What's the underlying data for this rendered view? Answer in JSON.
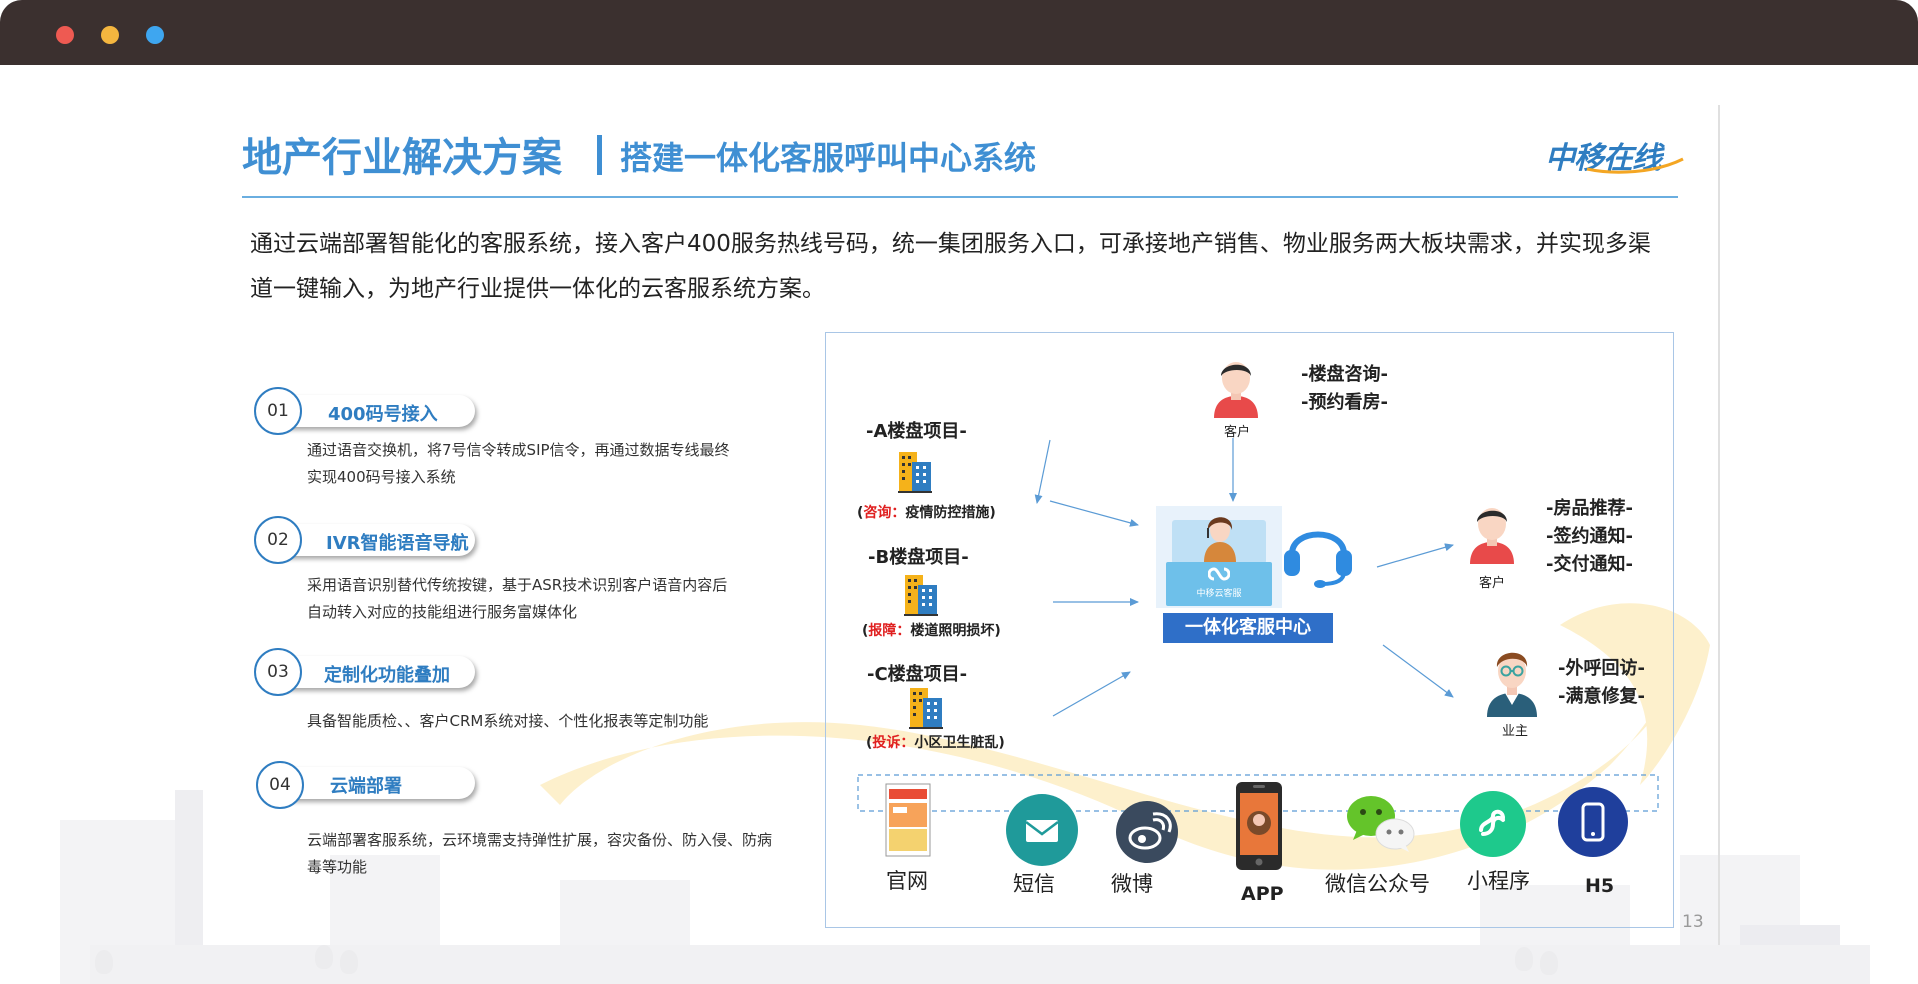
{
  "window": {
    "controls": [
      {
        "name": "close",
        "color": "#ee5a52"
      },
      {
        "name": "minimize",
        "color": "#f4b63f"
      },
      {
        "name": "maximize",
        "color": "#3ea6f0"
      }
    ]
  },
  "slide": {
    "title_main": "地产行业解决方案",
    "title_sub": "搭建一体化客服呼叫中心系统",
    "logo_text": "中移在线",
    "intro": "通过云端部署智能化的客服系统，接入客户400服务热线号码，统一集团服务入口，可承接地产销售、物业服务两大板块需求，并实现多渠道一键输入，为地产行业提供一体化的云客服系统方案。",
    "page_number": "13",
    "accent_color": "#3f8fd3"
  },
  "features": [
    {
      "num": "01",
      "title": "400码号接入",
      "desc": "通过语音交换机，将7号信令转成SIP信令，再通过数据专线最终实现400码号接入系统"
    },
    {
      "num": "02",
      "title": "IVR智能语音导航",
      "desc": "采用语音识别替代传统按键，基于ASR技术识别客户语音内容后自动转入对应的技能组进行服务富媒体化"
    },
    {
      "num": "03",
      "title": "定制化功能叠加",
      "desc": "具备智能质检、、客户CRM系统对接、个性化报表等定制功能"
    },
    {
      "num": "04",
      "title": "云端部署",
      "desc": "云端部署客服系统，云环境需支持弹性扩展，容灾备份、防入侵、防病毒等功能"
    }
  ],
  "diagram": {
    "projects": [
      {
        "label": "-A楼盘项目-",
        "tag_key": "咨询：",
        "tag_val": "疫情防控措施",
        "tag_open": "(",
        "tag_close": ")"
      },
      {
        "label": "-B楼盘项目-",
        "tag_key": "报障：",
        "tag_val": "楼道照明损坏",
        "tag_open": "(",
        "tag_close": ")"
      },
      {
        "label": "-C楼盘项目-",
        "tag_key": "投诉：",
        "tag_val": "小区卫生脏乱",
        "tag_open": "(",
        "tag_close": ")"
      }
    ],
    "top_customer": {
      "label": "客户",
      "lines": [
        "-楼盘咨询-",
        "-预约看房-"
      ]
    },
    "right_customer": {
      "label": "客户",
      "lines": [
        "-房品推荐-",
        "-签约通知-",
        "-交付通知-"
      ]
    },
    "owner": {
      "label": "业主",
      "lines": [
        "-外呼回访-",
        "-满意修复-"
      ]
    },
    "center_label": "一体化客服中心",
    "center_screen_text": "中移云客服",
    "channels": [
      {
        "label": "官网",
        "icon": "website-icon"
      },
      {
        "label": "短信",
        "icon": "sms-icon"
      },
      {
        "label": "微博",
        "icon": "weibo-icon"
      },
      {
        "label": "APP",
        "icon": "app-icon"
      },
      {
        "label": "微信公众号",
        "icon": "wechat-icon"
      },
      {
        "label": "小程序",
        "icon": "mini-program-icon"
      },
      {
        "label": "H5",
        "icon": "h5-icon"
      }
    ]
  }
}
